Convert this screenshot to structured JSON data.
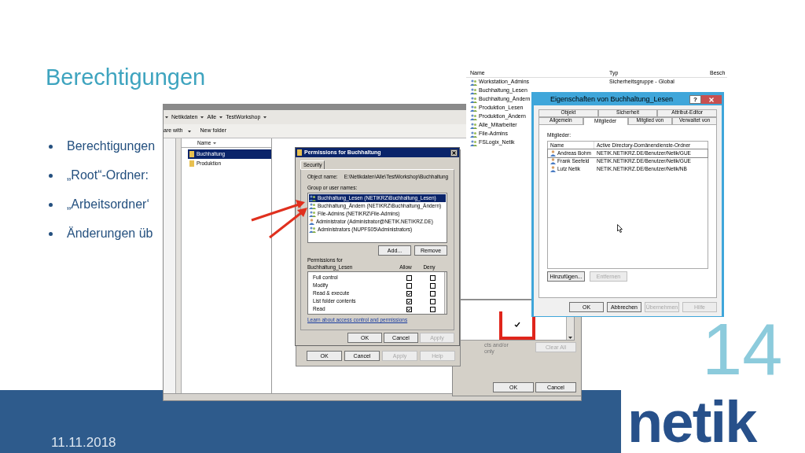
{
  "slide": {
    "title": "Berechtigungen",
    "bullets": [
      "Berechtigungen",
      "„Root“-Ordner:",
      "„Arbeitsordner‘",
      "Änderungen üb"
    ],
    "date": "11.11.2018",
    "page_number": "14",
    "logo": "netik"
  },
  "explorer": {
    "breadcrumb": [
      "Netikdaten",
      "Alle",
      "TestWorkshop"
    ],
    "toolbar": [
      "are with",
      "New folder"
    ],
    "column": "Name",
    "items": [
      {
        "name": "Buchhaltung",
        "selected": true
      },
      {
        "name": "Produktion",
        "selected": false
      }
    ]
  },
  "advanced_dialog": {
    "checked": true,
    "note_lines": [
      "cts and/or",
      "only"
    ],
    "clear_all": {
      "label": "Clear All",
      "disabled": true
    },
    "buttons": [
      {
        "label": "OK",
        "disabled": false
      },
      {
        "label": "Cancel",
        "disabled": false
      }
    ]
  },
  "folder_properties_buttons": [
    {
      "label": "OK",
      "disabled": false
    },
    {
      "label": "Cancel",
      "disabled": false
    },
    {
      "label": "Apply",
      "disabled": true
    },
    {
      "label": "Help",
      "disabled": true
    }
  ],
  "permissions_dialog": {
    "title": "Permissions for Buchhaltung",
    "tab": "Security",
    "object_label": "Object name:",
    "object_name": "E:\\Netikdaten\\Alle\\TestWorkshop\\Buchhaltung",
    "group_label": "Group or user names:",
    "principals": [
      {
        "kind": "group",
        "name": "Buchhaltung_Lesen (NETIKRZ\\Buchhaltung_Lesen)",
        "selected": true
      },
      {
        "kind": "group",
        "name": "Buchhaltung_Ändern (NETIKRZ\\Buchhaltung_Ändern)",
        "selected": false
      },
      {
        "kind": "group",
        "name": "File-Admins (NETIKRZ\\File-Admins)",
        "selected": false
      },
      {
        "kind": "user",
        "name": "Administrator (Administrator@NETIK.NETIKRZ.DE)",
        "selected": false
      },
      {
        "kind": "group",
        "name": "Administrators (NUPFS05\\Administrators)",
        "selected": false
      }
    ],
    "add": "Add...",
    "remove": "Remove",
    "permissions_label": "Permissions for",
    "permissions_for": "Buchhaltung_Lesen",
    "allow": "Allow",
    "deny": "Deny",
    "permissions": [
      {
        "name": "Full control",
        "allow": false,
        "deny": false
      },
      {
        "name": "Modify",
        "allow": false,
        "deny": false
      },
      {
        "name": "Read & execute",
        "allow": true,
        "deny": false
      },
      {
        "name": "List folder contents",
        "allow": true,
        "deny": false
      },
      {
        "name": "Read",
        "allow": true,
        "deny": false
      }
    ],
    "link": "Learn about access control and permissions",
    "buttons": [
      {
        "label": "OK",
        "disabled": false
      },
      {
        "label": "Cancel",
        "disabled": false
      },
      {
        "label": "Apply",
        "disabled": true
      }
    ]
  },
  "ad_list": {
    "columns": [
      "Name",
      "Typ",
      "Besch"
    ],
    "rows": [
      {
        "name": "Workstation_Admins",
        "type": "Sicherheitsgruppe - Global"
      },
      {
        "name": "Buchhaltung_Lesen"
      },
      {
        "name": "Buchhaltung_Ändern"
      },
      {
        "name": "Produktion_Lesen"
      },
      {
        "name": "Produktion_Ändern"
      },
      {
        "name": "Alle_Mitarbeiter"
      },
      {
        "name": "File-Admins"
      },
      {
        "name": "FSLogix_Netik"
      }
    ]
  },
  "properties": {
    "title": "Eigenschaften von Buchhaltung_Lesen",
    "help": "?",
    "tab_rows": [
      [
        {
          "label": "Objekt",
          "selected": false
        },
        {
          "label": "Sicherheit",
          "selected": false
        },
        {
          "label": "Attribut-Editor",
          "selected": false
        }
      ],
      [
        {
          "label": "Allgemein",
          "selected": false
        },
        {
          "label": "Mitglieder",
          "selected": true
        },
        {
          "label": "Mitglied von",
          "selected": false
        },
        {
          "label": "Verwaltet von",
          "selected": false
        }
      ]
    ],
    "members_label": "Mitglieder:",
    "columns": [
      "Name",
      "Active Directory-Domänendienste-Ordner"
    ],
    "members": [
      {
        "name": "Andreas Bohm",
        "folder": "NETIK.NETIKRZ.DE/Benutzer/Netik/GUE",
        "selected": true
      },
      {
        "name": "Frank Seefeld",
        "folder": "NETIK.NETIKRZ.DE/Benutzer/Netik/GUE",
        "selected": false
      },
      {
        "name": "Lutz Netik",
        "folder": "NETIK.NETIKRZ.DE/Benutzer/Netik/NB",
        "selected": false
      }
    ],
    "add": {
      "label": "Hinzufügen...",
      "disabled": false
    },
    "remove": {
      "label": "Entfernen",
      "disabled": true
    },
    "buttons": [
      {
        "label": "OK",
        "disabled": false
      },
      {
        "label": "Abbrechen",
        "disabled": false
      },
      {
        "label": "Übernehmen",
        "disabled": true
      },
      {
        "label": "Hilfe",
        "disabled": true
      }
    ]
  }
}
